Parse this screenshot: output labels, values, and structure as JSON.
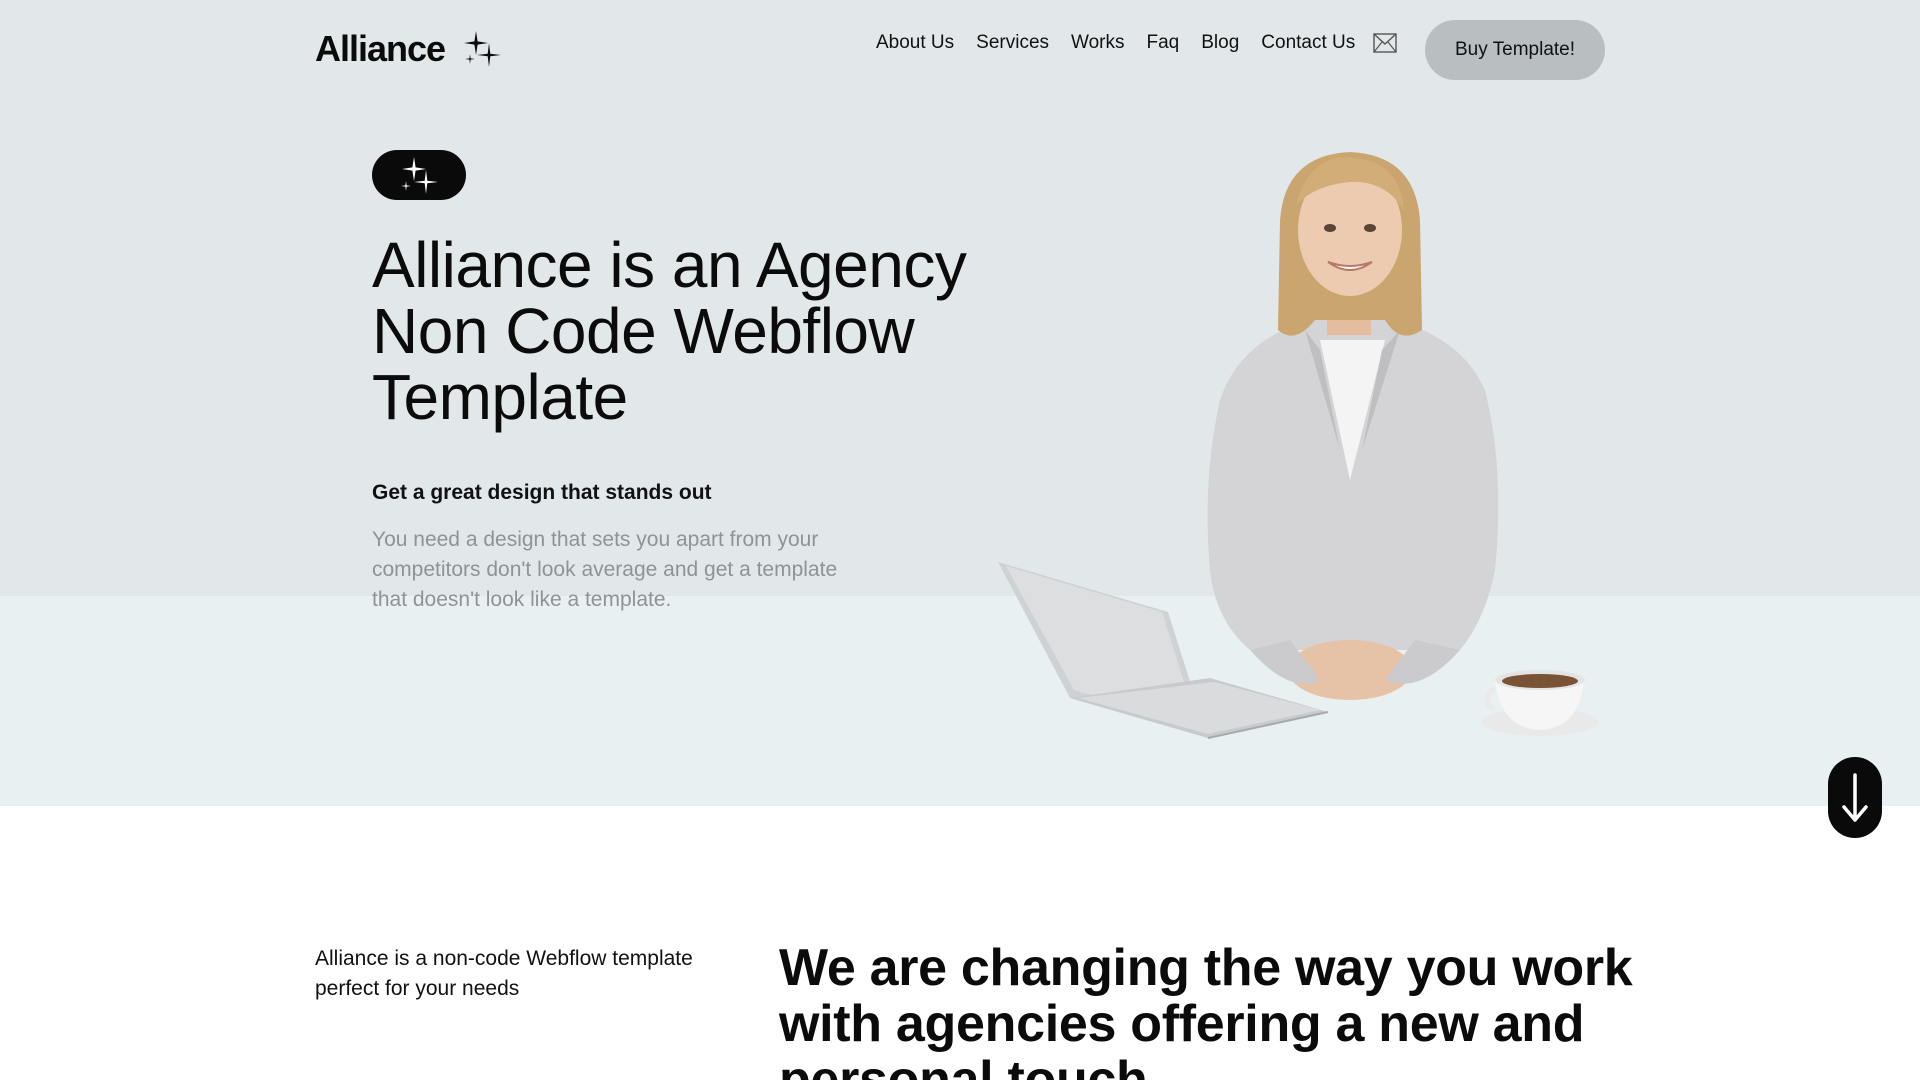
{
  "header": {
    "logo_text": "Alliance",
    "nav_items": [
      "About Us",
      "Services",
      "Works",
      "Faq",
      "Blog",
      "Contact Us"
    ],
    "mail_icon": "mail-icon",
    "buy_button": "Buy Template!"
  },
  "hero": {
    "badge_icon": "sparkle-icon",
    "title": "Alliance is an Agency Non Code Webflow Template",
    "subtitle": "Get a great design that stands out",
    "description": "You need a design that sets you apart from your competitors don't look average and get a template that doesn't look like a template.",
    "scroll_icon": "arrow-down-icon"
  },
  "about": {
    "intro": "Alliance is a non-code Webflow template perfect for your needs",
    "headline": "We are changing the way you work with agencies offering a new and personal touch"
  },
  "colors": {
    "hero_top": "#e2e8ea",
    "hero_bottom": "#e9f0f2",
    "button": "#b9bec1",
    "dark": "#0a0a0a",
    "muted_text": "#8e9396"
  }
}
